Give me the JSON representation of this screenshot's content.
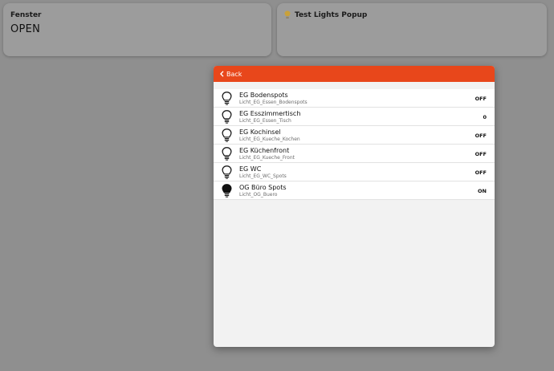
{
  "cards": {
    "fenster": {
      "title": "Fenster",
      "value": "OPEN"
    },
    "lights": {
      "title": "Test Lights Popup",
      "icon": "lightbulb-icon",
      "icon_color": "#c9a13a"
    }
  },
  "popup": {
    "header_color": "#e8471b",
    "back_label": "Back",
    "items": [
      {
        "label": "EG Bodenspots",
        "item": "Licht_EG_Essen_Bodenspots",
        "state": "OFF",
        "icon": "lightbulb-off-icon"
      },
      {
        "label": "EG Esszimmertisch",
        "item": "Licht_EG_Essen_Tisch",
        "state": "0",
        "icon": "lightbulb-off-icon"
      },
      {
        "label": "EG Kochinsel",
        "item": "Licht_EG_Kueche_Kochen",
        "state": "OFF",
        "icon": "lightbulb-off-icon"
      },
      {
        "label": "EG Küchenfront",
        "item": "Licht_EG_Kueche_Front",
        "state": "OFF",
        "icon": "lightbulb-off-icon"
      },
      {
        "label": "EG WC",
        "item": "Licht_EG_WC_Spots",
        "state": "OFF",
        "icon": "lightbulb-off-icon"
      },
      {
        "label": "OG Büro Spots",
        "item": "Licht_OG_Buero",
        "state": "ON",
        "icon": "lightbulb-on-icon"
      }
    ]
  }
}
